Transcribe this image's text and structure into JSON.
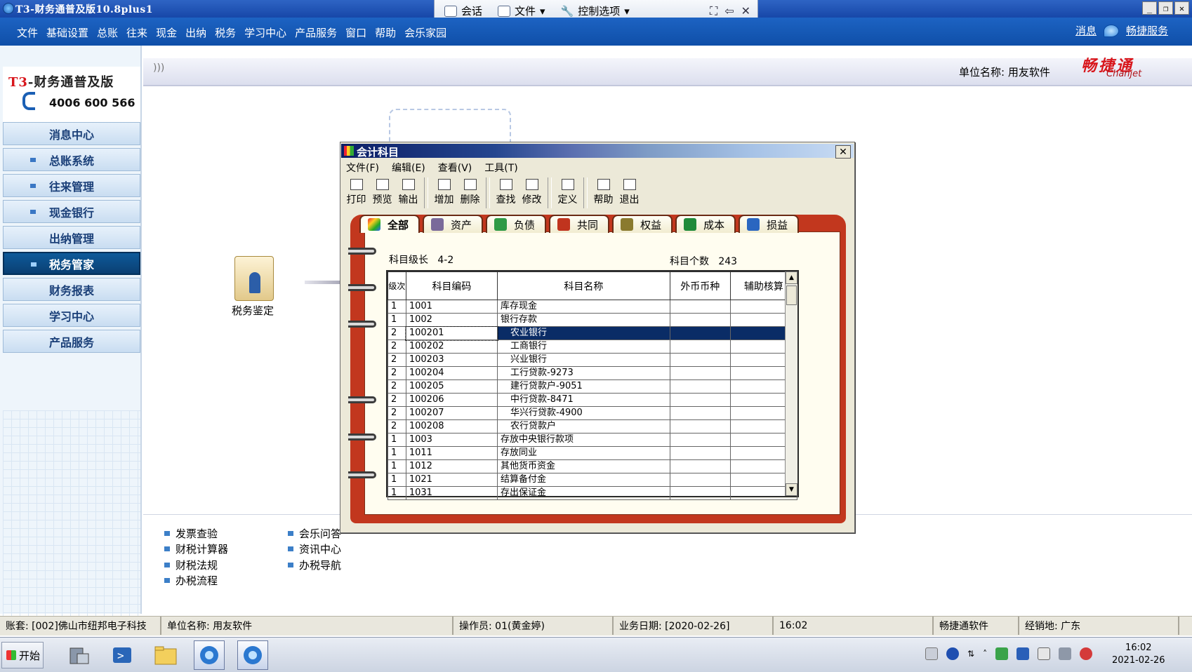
{
  "window": {
    "title": "T3-财务通普及版10.8plus1"
  },
  "remote_bar": {
    "session": "会话",
    "file": "文件",
    "control": "控制选项"
  },
  "menubar": {
    "items": [
      "文件",
      "基础设置",
      "总账",
      "往来",
      "现金",
      "出纳",
      "税务",
      "学习中心",
      "产品服务",
      "窗口",
      "帮助",
      "会乐家园"
    ],
    "message": "消息",
    "service": "畅捷服务"
  },
  "leftpanel": {
    "logo_prefix": "T3",
    "logo_suffix": "-财务通普及版",
    "phone": "4006 600 566",
    "nav": [
      {
        "label": "消息中心",
        "bullet": false
      },
      {
        "label": "总账系统",
        "bullet": true
      },
      {
        "label": "往来管理",
        "bullet": true
      },
      {
        "label": "现金银行",
        "bullet": true
      },
      {
        "label": "出纳管理",
        "bullet": false
      },
      {
        "label": "税务管家",
        "bullet": true,
        "active": true
      },
      {
        "label": "财务报表",
        "bullet": false
      },
      {
        "label": "学习中心",
        "bullet": false
      },
      {
        "label": "产品服务",
        "bullet": false
      }
    ]
  },
  "header": {
    "chevron": ")))",
    "unit_name": "单位名称: 用友软件",
    "brand": "畅捷通",
    "brand_sub": "Chanjet"
  },
  "desktop": {
    "icon_label": "税务鉴定",
    "links_left": [
      "发票查验",
      "财税计算器",
      "财税法规",
      "办税流程"
    ],
    "links_right": [
      "会乐问答",
      "资讯中心",
      "办税导航"
    ]
  },
  "dialog": {
    "title": "会计科目",
    "close": "✕",
    "menu": [
      "文件(F)",
      "编辑(E)",
      "查看(V)",
      "工具(T)"
    ],
    "toolbar": [
      "打印",
      "预览",
      "输出",
      "增加",
      "删除",
      "查找",
      "修改",
      "定义",
      "帮助",
      "退出"
    ],
    "tabs": [
      "全部",
      "资产",
      "负债",
      "共同",
      "权益",
      "成本",
      "损益"
    ],
    "level_label": "科目级长",
    "level_value": "4-2",
    "count_label": "科目个数",
    "count_value": "243",
    "columns": [
      "级次",
      "科目编码",
      "科目名称",
      "外币币种",
      "辅助核算"
    ],
    "rows": [
      {
        "level": "1",
        "code": "1001",
        "name": "库存现金"
      },
      {
        "level": "1",
        "code": "1002",
        "name": "银行存款"
      },
      {
        "level": "2",
        "code": "100201",
        "name": "农业银行",
        "selected": true
      },
      {
        "level": "2",
        "code": "100202",
        "name": "工商银行"
      },
      {
        "level": "2",
        "code": "100203",
        "name": "兴业银行"
      },
      {
        "level": "2",
        "code": "100204",
        "name": "工行贷款-9273"
      },
      {
        "level": "2",
        "code": "100205",
        "name": "建行贷款户-9051"
      },
      {
        "level": "2",
        "code": "100206",
        "name": "中行贷款-8471"
      },
      {
        "level": "2",
        "code": "100207",
        "name": "华兴行贷款-4900"
      },
      {
        "level": "2",
        "code": "100208",
        "name": "农行贷款户"
      },
      {
        "level": "1",
        "code": "1003",
        "name": "存放中央银行款项"
      },
      {
        "level": "1",
        "code": "1011",
        "name": "存放同业"
      },
      {
        "level": "1",
        "code": "1012",
        "name": "其他货币资金"
      },
      {
        "level": "1",
        "code": "1021",
        "name": "结算备付金"
      },
      {
        "level": "1",
        "code": "1031",
        "name": "存出保证金"
      }
    ]
  },
  "statusbar": {
    "account": "账套: [002]佛山市纽邦电子科技",
    "unit": "单位名称: 用友软件",
    "operator": "操作员: 01(黄金婷)",
    "date": "业务日期: [2020-02-26]",
    "time": "16:02",
    "vendor": "畅捷通软件",
    "dealer": "经销地: 广东"
  },
  "taskbar": {
    "start": "开始",
    "clock_time": "16:02",
    "clock_date": "2021-02-26"
  },
  "colors": {
    "accent": "#1d63c3",
    "selection": "#0a2c66",
    "binder": "#c2371e",
    "brand": "#d8161c"
  }
}
